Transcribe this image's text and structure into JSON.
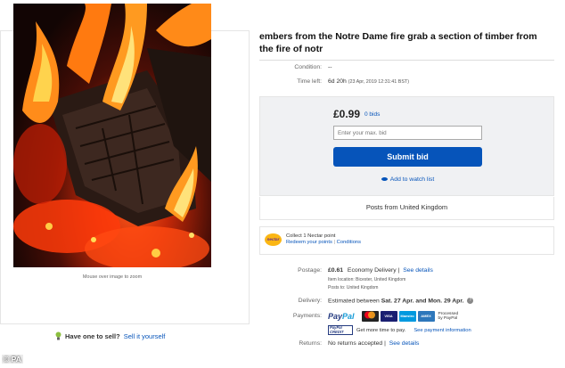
{
  "listing": {
    "title": "embers from  the  Notre Dame fire grab a section of timber from the fire of notr",
    "image_hint": "Mouse over image to zoom"
  },
  "details": {
    "condition_label": "Condition:",
    "condition_value": "--",
    "time_left_label": "Time left:",
    "time_left_value": "6d 20h",
    "time_left_detail": "(23 Apr, 2019  12:31:41 BST)"
  },
  "bid": {
    "price": "£0.99",
    "bids": "0 bids",
    "input_placeholder": "Enter your max. bid",
    "button_label": "Submit bid",
    "watch_label": "Add to watch list",
    "posts_from": "Posts from United Kingdom"
  },
  "nectar": {
    "logo_text": "nectar",
    "line1": "Collect 1 Nectar point",
    "redeem_link": "Redeem your points",
    "separator": "|",
    "conditions_link": "Conditions"
  },
  "postage": {
    "label": "Postage:",
    "price": "£0.61",
    "method": "Economy Delivery",
    "separator": "|",
    "see_details": "See details",
    "item_location": "Item location:  Bicester, United Kingdom",
    "posts_to": "Posts to:  United Kingdom"
  },
  "delivery": {
    "label": "Delivery:",
    "prefix": "Estimated between",
    "dates": "Sat. 27 Apr. and Mon. 29 Apr.",
    "help_icon": "?"
  },
  "payments": {
    "label": "Payments:",
    "paypal_pay": "Pay",
    "paypal_pal": "Pal",
    "cards": [
      {
        "name": "MC",
        "color": "#eb001b"
      },
      {
        "name": "VISA",
        "color": "#1a1f71"
      },
      {
        "name": "Maestro",
        "color": "#0099df"
      },
      {
        "name": "AMEX",
        "color": "#2e77bb"
      }
    ],
    "processed_line1": "Processed",
    "processed_line2": "by PayPal",
    "credit_logo_line1": "PayPal",
    "credit_logo_line2": "CREDIT",
    "credit_text": "Get more time to pay.",
    "credit_link": "See payment information"
  },
  "returns": {
    "label": "Returns:",
    "value": "No returns accepted",
    "separator": "|",
    "see_details": "See details"
  },
  "sell": {
    "label": "Have one to sell?",
    "link": "Sell it yourself"
  },
  "watermark": "© PA",
  "colors": {
    "link": "#0654ba",
    "button": "#0654ba",
    "bid_box_bg": "#f0f1f3"
  }
}
